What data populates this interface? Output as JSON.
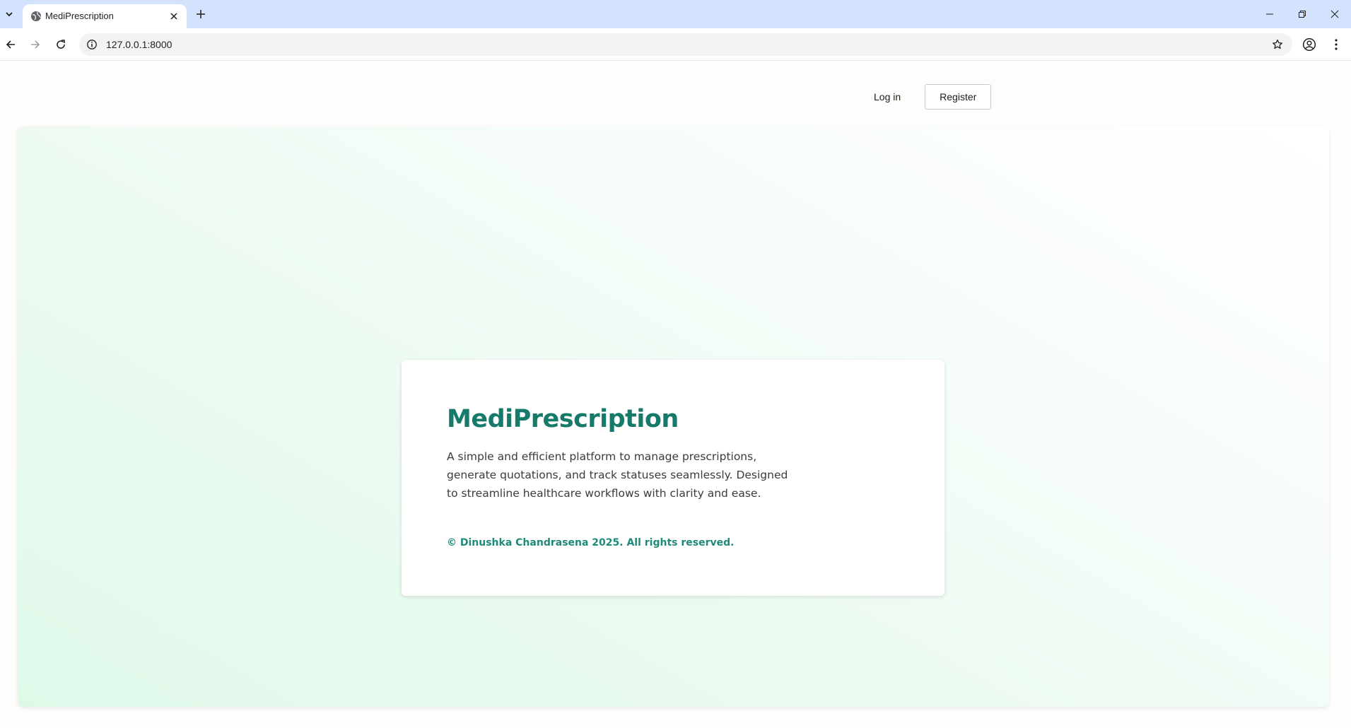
{
  "browser": {
    "tab_title": "MediPrescription",
    "url": "127.0.0.1:8000"
  },
  "nav": {
    "login_label": "Log in",
    "register_label": "Register"
  },
  "card": {
    "title": "MediPrescription",
    "description": "A simple and efficient platform to manage prescriptions, generate quotations, and track statuses seamlessly. Designed to streamline healthcare workflows with clarity and ease.",
    "footer": "© Dinushka Chandrasena 2025. All rights reserved."
  },
  "colors": {
    "accent": "#167a6a",
    "footer_accent": "#1f8a7a",
    "tabbar": "#d3e3fd"
  }
}
